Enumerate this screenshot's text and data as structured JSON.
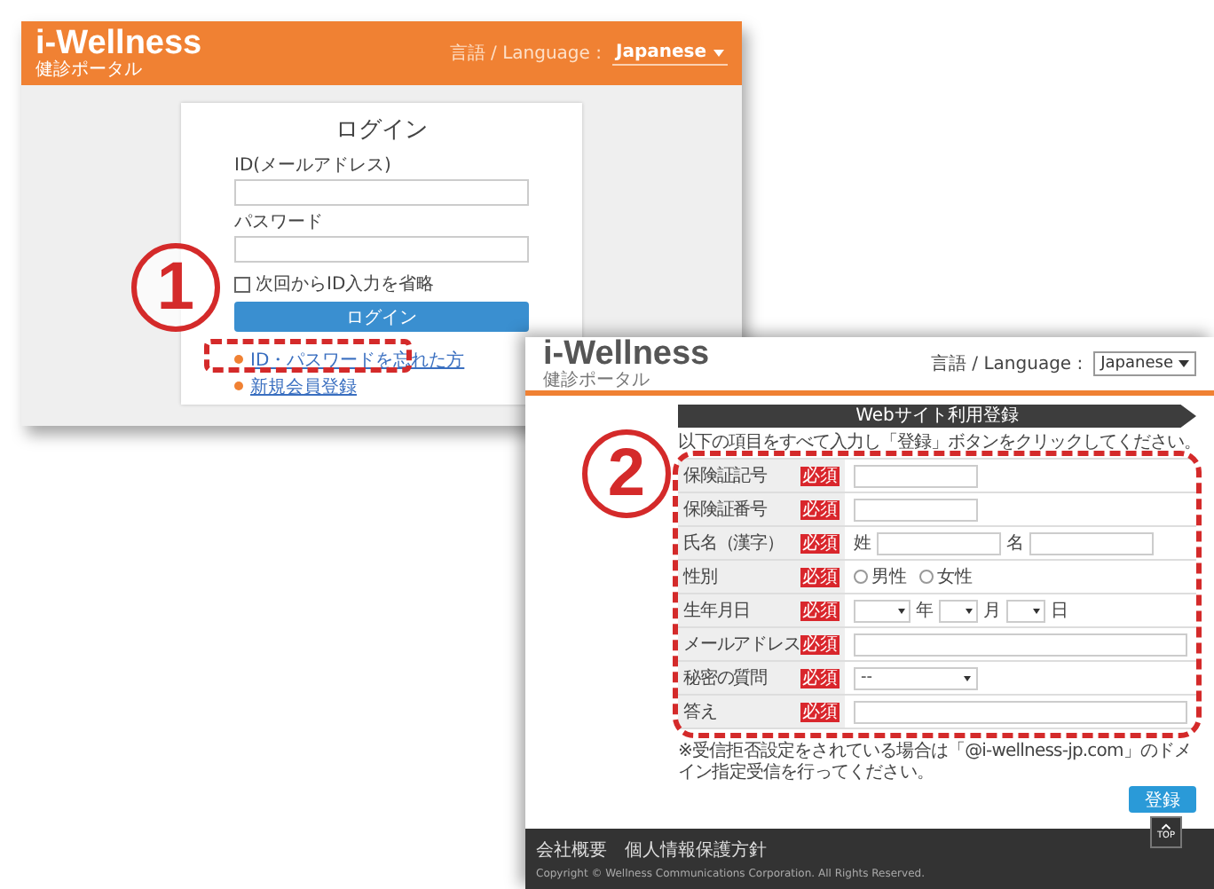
{
  "login_screen": {
    "logo": "i-Wellness",
    "logo_sub": "健診ポータル",
    "language_label": "言語 / Language :",
    "language_value": "Japanese",
    "title": "ログイン",
    "fields": [
      {
        "label": "ID(メールアドレス)"
      },
      {
        "label": "パスワード"
      }
    ],
    "remember": {
      "label": "次回からID入力を省略",
      "checked": false
    },
    "login_button": "ログイン",
    "links": [
      "ID・パスワードを忘れた方",
      "新規会員登録"
    ]
  },
  "registration_screen": {
    "logo": "i-Wellness",
    "logo_sub": "健診ポータル",
    "language_label": "言語 / Language :",
    "language_value": "Japanese",
    "banner": "Webサイト利用登録",
    "instruction": "以下の項目をすべて入力し「登録」ボタンをクリックしてください。",
    "rows": [
      {
        "label": "保険証記号",
        "badge": "必須",
        "kind": "short"
      },
      {
        "label": "保険証番号",
        "badge": "必須",
        "kind": "short"
      },
      {
        "label": "氏名（漢字）",
        "badge": "必須",
        "kind": "name",
        "parts": [
          "姓",
          "名"
        ]
      },
      {
        "label": "性別",
        "badge": "必須",
        "kind": "radio",
        "options": [
          {
            "label": "男性",
            "selected": false
          },
          {
            "label": "女性",
            "selected": false
          }
        ]
      },
      {
        "label": "生年月日",
        "badge": "必須",
        "kind": "date",
        "parts": [
          "年",
          "月",
          "日"
        ]
      },
      {
        "label": "メールアドレス",
        "badge": "必須",
        "kind": "wide"
      },
      {
        "label": "秘密の質問",
        "badge": "必須",
        "kind": "select",
        "value": "--"
      },
      {
        "label": "答え",
        "badge": "必須",
        "kind": "wide"
      }
    ],
    "note": "※受信拒否設定をされている場合は「@i-wellness-jp.com」のドメイン指定受信を行ってください。",
    "submit": "登録",
    "top_label": "TOP",
    "footer_links": [
      "会社概要",
      "個人情報保護方針"
    ],
    "copyright": "Copyright © Wellness Communications Corporation. All Rights Reserved."
  },
  "annotations": [
    {
      "number": "1"
    },
    {
      "number": "2"
    }
  ]
}
